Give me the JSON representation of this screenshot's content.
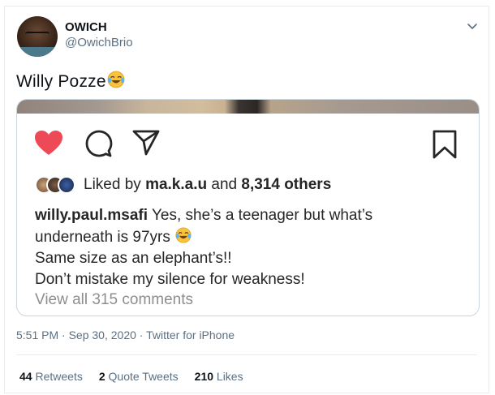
{
  "author": {
    "display_name": "OWICH",
    "handle": "@OwichBrio"
  },
  "tweet": {
    "text": "Willy Pozze",
    "emoji": "face-with-tears-of-joy-icon"
  },
  "embedded_post": {
    "likes": {
      "prefix": "Liked by",
      "user": "ma.k.a.u",
      "conjunction": "and",
      "count": "8,314 others"
    },
    "caption": {
      "username": "willy.paul.msafi",
      "line1": "Yes, she’s a teenager but what’s",
      "line2": "underneath is 97yrs",
      "line3": "Same size as an elephant’s!!",
      "line4": "Don’t mistake my silence for weakness!"
    },
    "view_comments": "View all 315 comments"
  },
  "meta": {
    "time": "5:51 PM",
    "sep1": " · ",
    "date": "Sep 30, 2020",
    "sep2": " · ",
    "source": "Twitter for iPhone"
  },
  "stats": {
    "retweets_count": "44",
    "retweets_label": "Retweets",
    "quotes_count": "2",
    "quotes_label": "Quote Tweets",
    "likes_count": "210",
    "likes_label": "Likes"
  },
  "colors": {
    "heart": "#ed4956",
    "muted": "#5b7083",
    "border": "#e6ecf0"
  }
}
